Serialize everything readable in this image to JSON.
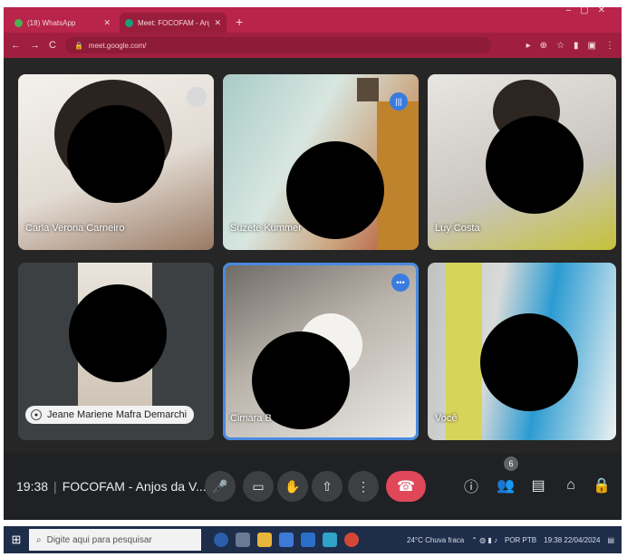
{
  "browser": {
    "tabs": [
      {
        "label": "(18) WhatsApp",
        "color": "#4caf50"
      },
      {
        "label": "Meet: FOCOFAM - Anjos d",
        "color": "#19a07a"
      }
    ],
    "url": "meet.google.com/",
    "new_tab": "+"
  },
  "meet": {
    "tiles": [
      {
        "name": "Carla Verona Carneiro",
        "type": "name"
      },
      {
        "name": "Suzete Kummer",
        "type": "name"
      },
      {
        "name": "Luy Costa",
        "type": "name"
      },
      {
        "name": "Jeane Mariene Mafra Demarchi",
        "type": "pill"
      },
      {
        "name": "Cimara B",
        "type": "name"
      },
      {
        "name": "Você",
        "type": "name"
      }
    ],
    "time": "19:38",
    "meeting_title": "FOCOFAM - Anjos da V...",
    "participants_count": "6"
  },
  "taskbar": {
    "search_placeholder": "Digite aqui para pesquisar",
    "weather": "24°C Chuva fraca",
    "clock_time": "19:38",
    "clock_date": "22/04/2024",
    "lang": "POR PTB"
  },
  "colors": {
    "browser_accent": "#b8244a",
    "end_call": "#e0485a",
    "active_speaker": "#4a8ae0"
  }
}
